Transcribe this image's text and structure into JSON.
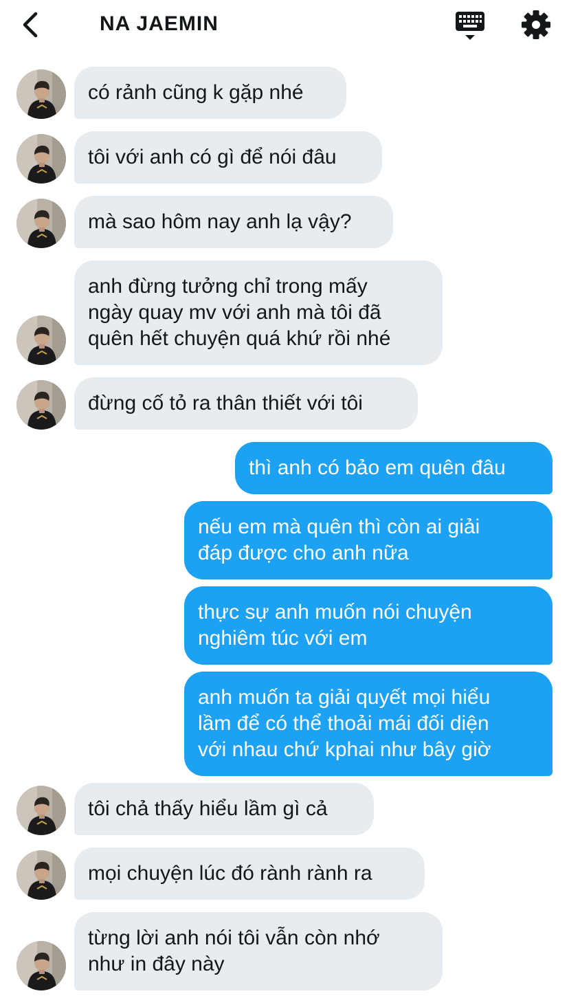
{
  "header": {
    "title": "NA JAEMIN",
    "back_icon": "chevron-left-icon",
    "keyboard_icon": "keyboard-icon",
    "settings_icon": "gear-icon"
  },
  "colors": {
    "incoming_bubble": "#e6ecf0",
    "outgoing_bubble": "#1da1f2",
    "text": "#14171a"
  },
  "messages": [
    {
      "from": "them",
      "text": "có rảnh cũng k gặp nhé"
    },
    {
      "from": "them",
      "text": "tôi với anh có gì để nói đâu"
    },
    {
      "from": "them",
      "text": "mà sao hôm nay anh lạ vậy?"
    },
    {
      "from": "them",
      "text": "anh đừng tưởng chỉ trong mấy\nngày quay mv với anh mà tôi đã\nquên hết chuyện quá khứ rồi nhé"
    },
    {
      "from": "them",
      "text": "đừng cố tỏ ra thân thiết với tôi"
    },
    {
      "from": "me",
      "text": "thì anh có bảo em quên đâu"
    },
    {
      "from": "me",
      "text": "nếu em mà quên thì còn ai giải\nđáp được cho anh nữa"
    },
    {
      "from": "me",
      "text": "thực sự anh muốn nói chuyện\nnghiêm túc với em"
    },
    {
      "from": "me",
      "text": "anh muốn ta giải quyết mọi hiểu\nlầm để có thể thoải mái đối diện\nvới nhau chứ kphai như bây giờ"
    },
    {
      "from": "them",
      "text": "tôi chả thấy hiểu lầm gì cả"
    },
    {
      "from": "them",
      "text": "mọi chuyện lúc đó rành rành ra"
    },
    {
      "from": "them",
      "text": "từng lời anh nói tôi vẫn còn nhớ\nnhư in đây này"
    }
  ]
}
